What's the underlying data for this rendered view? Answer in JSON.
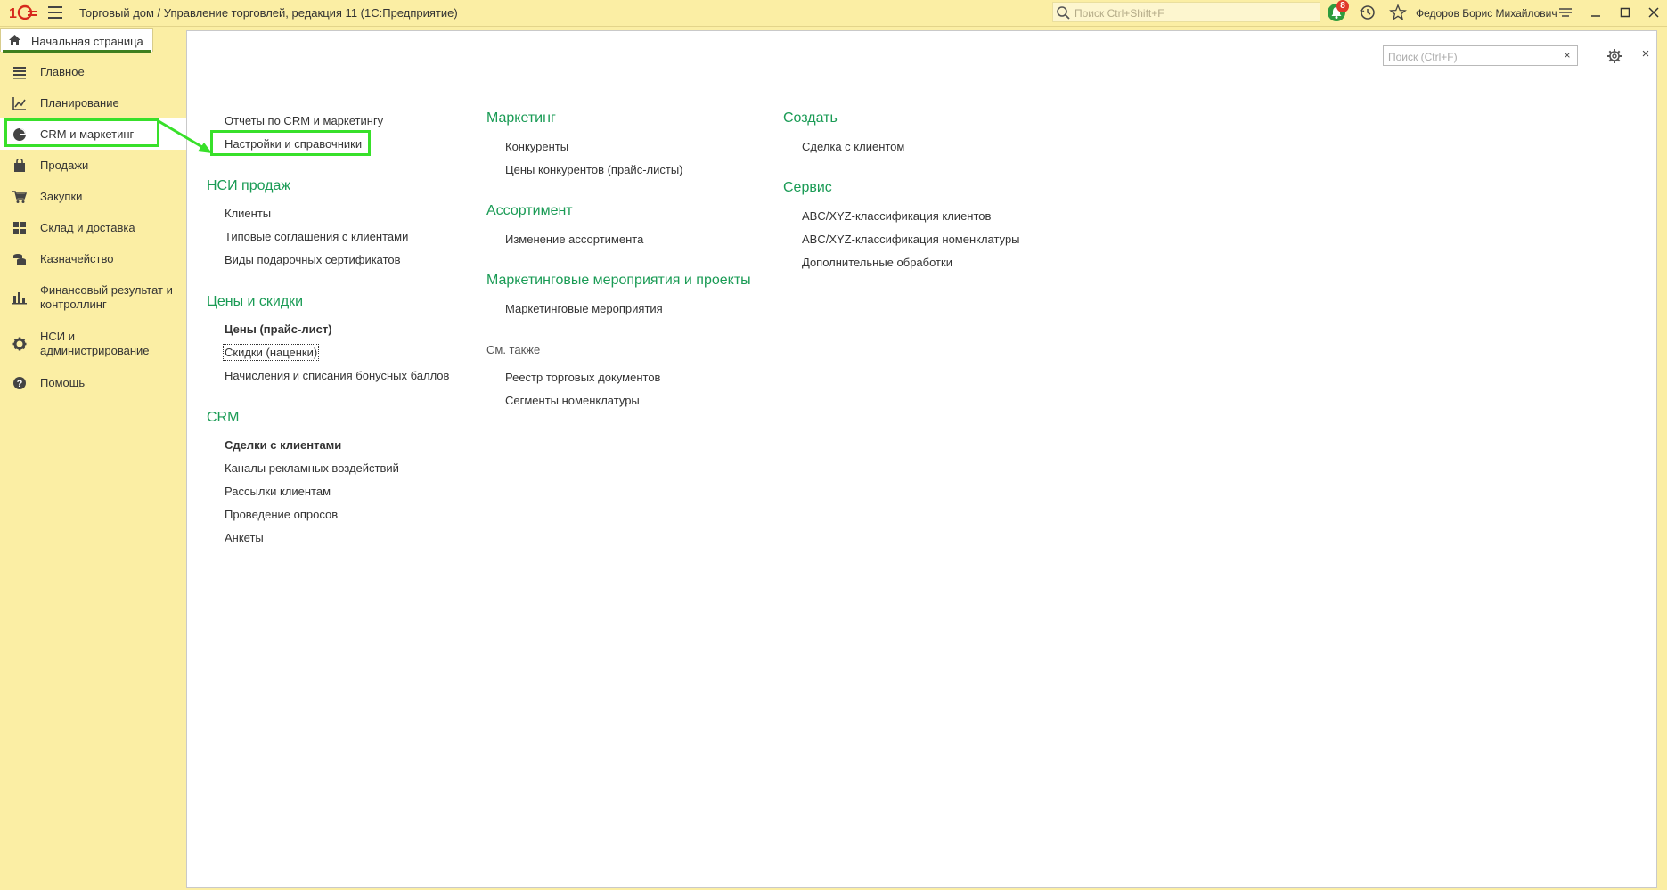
{
  "window": {
    "app_title": "Торговый дом / Управление торговлей, редакция 11  (1С:Предприятие)",
    "search_placeholder": "Поиск Ctrl+Shift+F",
    "notification_count": "8",
    "user_name": "Федоров Борис Михайлович"
  },
  "tabs": {
    "home_label": "Начальная страница"
  },
  "sidebar": {
    "items": [
      {
        "label": "Главное",
        "icon": "list-icon"
      },
      {
        "label": "Планирование",
        "icon": "planning-chart-icon"
      },
      {
        "label": "CRM и маркетинг",
        "icon": "pie-chart-icon",
        "active": true
      },
      {
        "label": "Продажи",
        "icon": "shopping-bag-icon"
      },
      {
        "label": "Закупки",
        "icon": "cart-icon"
      },
      {
        "label": "Склад и доставка",
        "icon": "warehouse-grid-icon"
      },
      {
        "label": "Казначейство",
        "icon": "coins-icon"
      },
      {
        "label": "Финансовый результат и контроллинг",
        "icon": "bar-chart-icon"
      },
      {
        "label": "НСИ и администрирование",
        "icon": "gear-icon"
      },
      {
        "label": "Помощь",
        "icon": "help-icon"
      }
    ]
  },
  "panel": {
    "search_placeholder": "Поиск (Ctrl+F)",
    "clear_symbol": "×",
    "close_symbol": "×",
    "col1": {
      "top_links": [
        "Отчеты по CRM и маркетингу",
        "Настройки и справочники"
      ],
      "nsi_head": "НСИ продаж",
      "nsi_links": [
        "Клиенты",
        "Типовые соглашения с клиентами",
        "Виды подарочных сертификатов"
      ],
      "prices_head": "Цены и скидки",
      "prices_links": [
        "Цены (прайс-лист)",
        "Скидки (наценки)",
        "Начисления и списания бонусных баллов"
      ],
      "crm_head": "CRM",
      "crm_links": [
        "Сделки с клиентами",
        "Каналы рекламных воздействий",
        "Рассылки клиентам",
        "Проведение опросов",
        "Анкеты"
      ]
    },
    "col2": {
      "marketing_head": "Маркетинг",
      "marketing_links": [
        "Конкуренты",
        "Цены конкурентов (прайс-листы)"
      ],
      "assortment_head": "Ассортимент",
      "assortment_links": [
        "Изменение ассортимента"
      ],
      "events_head": "Маркетинговые мероприятия и проекты",
      "events_links": [
        "Маркетинговые мероприятия"
      ],
      "see_also": "См. также",
      "see_also_links": [
        "Реестр торговых документов",
        "Сегменты номенклатуры"
      ]
    },
    "col3": {
      "create_head": "Создать",
      "create_links": [
        "Сделка с клиентом"
      ],
      "service_head": "Сервис",
      "service_links": [
        "ABC/XYZ-классификация клиентов",
        "ABC/XYZ-классификация номенклатуры",
        "Дополнительные обработки"
      ]
    }
  },
  "colors": {
    "accent_green": "#1a9b55",
    "highlight": "#38e02a",
    "bg_yellow": "#fbeea4"
  }
}
